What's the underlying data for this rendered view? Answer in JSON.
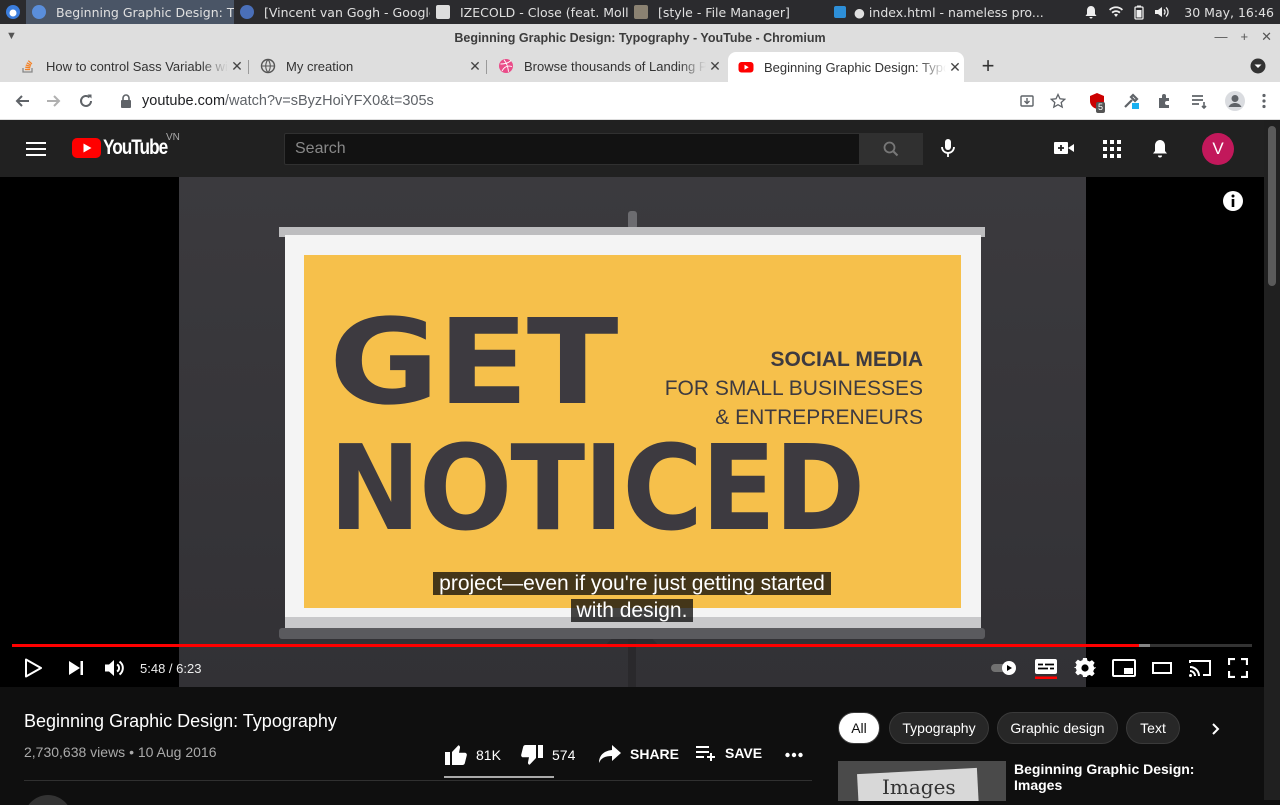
{
  "taskbar": {
    "tasks": [
      {
        "label": "Beginning Graphic Design: T..."
      },
      {
        "label": "[Vincent van Gogh - Google ..."
      },
      {
        "label": "IZECOLD - Close (feat. Molly..."
      },
      {
        "label": "[style - File Manager]"
      },
      {
        "label": "index.html - nameless pro..."
      }
    ],
    "datetime": "30 May, 16:46"
  },
  "window": {
    "title": "Beginning Graphic Design: Typography - YouTube - Chromium"
  },
  "tabs": [
    {
      "label": "How to control Sass Variable with"
    },
    {
      "label": "My creation"
    },
    {
      "label": "Browse thousands of Landing Page"
    },
    {
      "label": "Beginning Graphic Design: Typography"
    }
  ],
  "omnibox": {
    "host": "youtube.com",
    "path": "/watch?v=sByzHoiYFX0&t=305s",
    "ext_badge": "5"
  },
  "youtube": {
    "logo": "YouTube",
    "region": "VN",
    "search_placeholder": "Search",
    "avatar_letter": "V"
  },
  "video": {
    "slide": {
      "big_line1": "GET",
      "big_line2": "NOTICED",
      "side_line1": "SOCIAL MEDIA",
      "side_line2": "FOR SMALL BUSINESSES",
      "side_line3": "& ENTREPRENEURS"
    },
    "subtitle_line1": "project—even if you're just getting started",
    "subtitle_line2": "with design.",
    "time": "5:48 / 6:23",
    "played_fraction": 0.909,
    "loaded_fraction": 0.918
  },
  "details": {
    "title": "Beginning Graphic Design: Typography",
    "meta": "2,730,638 views • 10 Aug 2016",
    "likes": "81K",
    "dislikes": "574",
    "share": "SHARE",
    "save": "SAVE"
  },
  "chips": [
    {
      "label": "All"
    },
    {
      "label": "Typography"
    },
    {
      "label": "Graphic design"
    },
    {
      "label": "Text"
    }
  ],
  "recommendation": {
    "title": "Beginning Graphic Design: Images",
    "thumb_text": "Images"
  },
  "colors": {
    "accent": "#ff0000",
    "slide_yellow": "#f6c04b",
    "slide_text": "#3d3a40"
  }
}
